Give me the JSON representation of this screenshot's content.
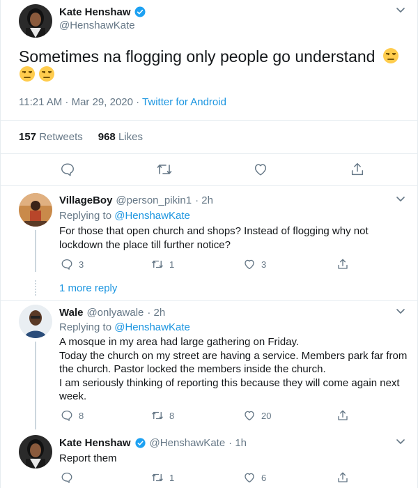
{
  "main_tweet": {
    "name": "Kate Henshaw",
    "handle": "@HenshawKate",
    "text": "Sometimes na flogging only people go understand",
    "timestamp": "11:21 AM · Mar 29, 2020 · ",
    "source": "Twitter for Android",
    "retweets_count": "157",
    "retweets_label": "Retweets",
    "likes_count": "968",
    "likes_label": "Likes"
  },
  "replies": [
    {
      "name": "VillageBoy",
      "handle": "@person_pikin1",
      "time": "· 2h",
      "replying_prefix": "Replying to ",
      "replying_to": "@HenshawKate",
      "text_lines": [
        "For those that open church and shops? Instead of flogging why not",
        "lockdown the place till further notice?"
      ],
      "reply_count": "3",
      "retweet_count": "1",
      "like_count": "3",
      "more_replies": "1 more reply"
    },
    {
      "name": "Wale",
      "handle": "@onlyawale",
      "time": "· 2h",
      "replying_prefix": "Replying to ",
      "replying_to": "@HenshawKate",
      "text_lines": [
        "A mosque in my area had large gathering on Friday.",
        "Today the church on my street are having a service. Members park far from",
        "the church. Pastor locked the members inside the church.",
        "I am seriously thinking of reporting this because they will come again next",
        "week."
      ],
      "reply_count": "8",
      "retweet_count": "8",
      "like_count": "20"
    },
    {
      "name": "Kate Henshaw",
      "handle": "@HenshawKate",
      "time": "· 1h",
      "text": "Report them",
      "reply_count": "",
      "retweet_count": "1",
      "like_count": "6"
    }
  ],
  "colors": {
    "link": "#1b95e0",
    "muted": "#657786",
    "text": "#14171a",
    "verified": "#1da1f2",
    "border": "#e6ecf0"
  }
}
